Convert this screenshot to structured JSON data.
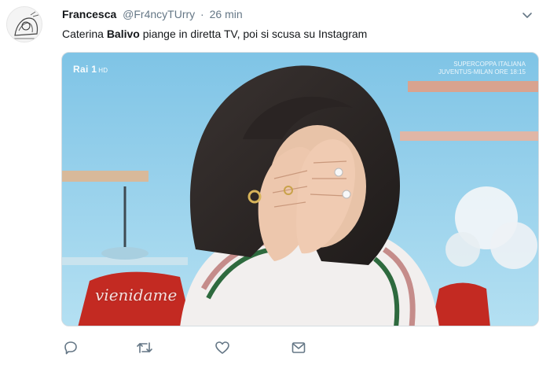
{
  "tweet": {
    "display_name": "Francesca",
    "handle": "@Fr4ncyTUrry",
    "separator": "·",
    "time": "26 min",
    "text_before": "Caterina ",
    "text_bold": "Balivo",
    "text_after": " piange in diretta TV, poi si scusa su Instagram"
  },
  "media": {
    "channel_logo": "Rai",
    "channel_number": "1",
    "channel_hd": "HD",
    "ticker_line1": "SUPERCOPPA ITALIANA",
    "ticker_line2": "JUVENTUS-MILAN ORE 18:15",
    "show_logo": "vienidame"
  },
  "icons": {
    "reply": "reply-icon",
    "retweet": "retweet-icon",
    "like": "heart-icon",
    "message": "envelope-icon",
    "menu": "chevron-down-icon"
  },
  "colors": {
    "text": "#14171a",
    "muted": "#657786",
    "icon": "#657786"
  }
}
